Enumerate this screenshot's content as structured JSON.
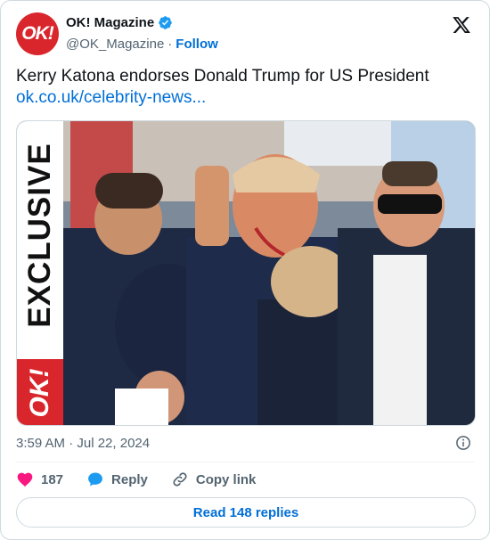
{
  "author": {
    "avatar_text": "OK!",
    "display_name": "OK! Magazine",
    "handle": "@OK_Magazine",
    "separator": "·",
    "follow_label": "Follow"
  },
  "tweet": {
    "text": "Kerry Katona endorses Donald Trump for US President",
    "link": "ok.co.uk/celebrity-news..."
  },
  "media": {
    "brand_text": "OK!",
    "overlay_text": "EXCLUSIVE"
  },
  "timestamp": "3:59 AM · Jul 22, 2024",
  "actions": {
    "like_count": "187",
    "reply_label": "Reply",
    "copy_link_label": "Copy link"
  },
  "read_replies_label": "Read 148 replies",
  "colors": {
    "accent": "#006fd6",
    "brand_red": "#d9262c",
    "like_red": "#f91880",
    "verified": "#1d9bf0"
  },
  "icons": {
    "verified": "verified-badge-icon",
    "x_logo": "x-logo-icon",
    "info": "info-icon",
    "like": "heart-icon",
    "reply": "speech-bubble-icon",
    "copy_link": "link-icon"
  }
}
